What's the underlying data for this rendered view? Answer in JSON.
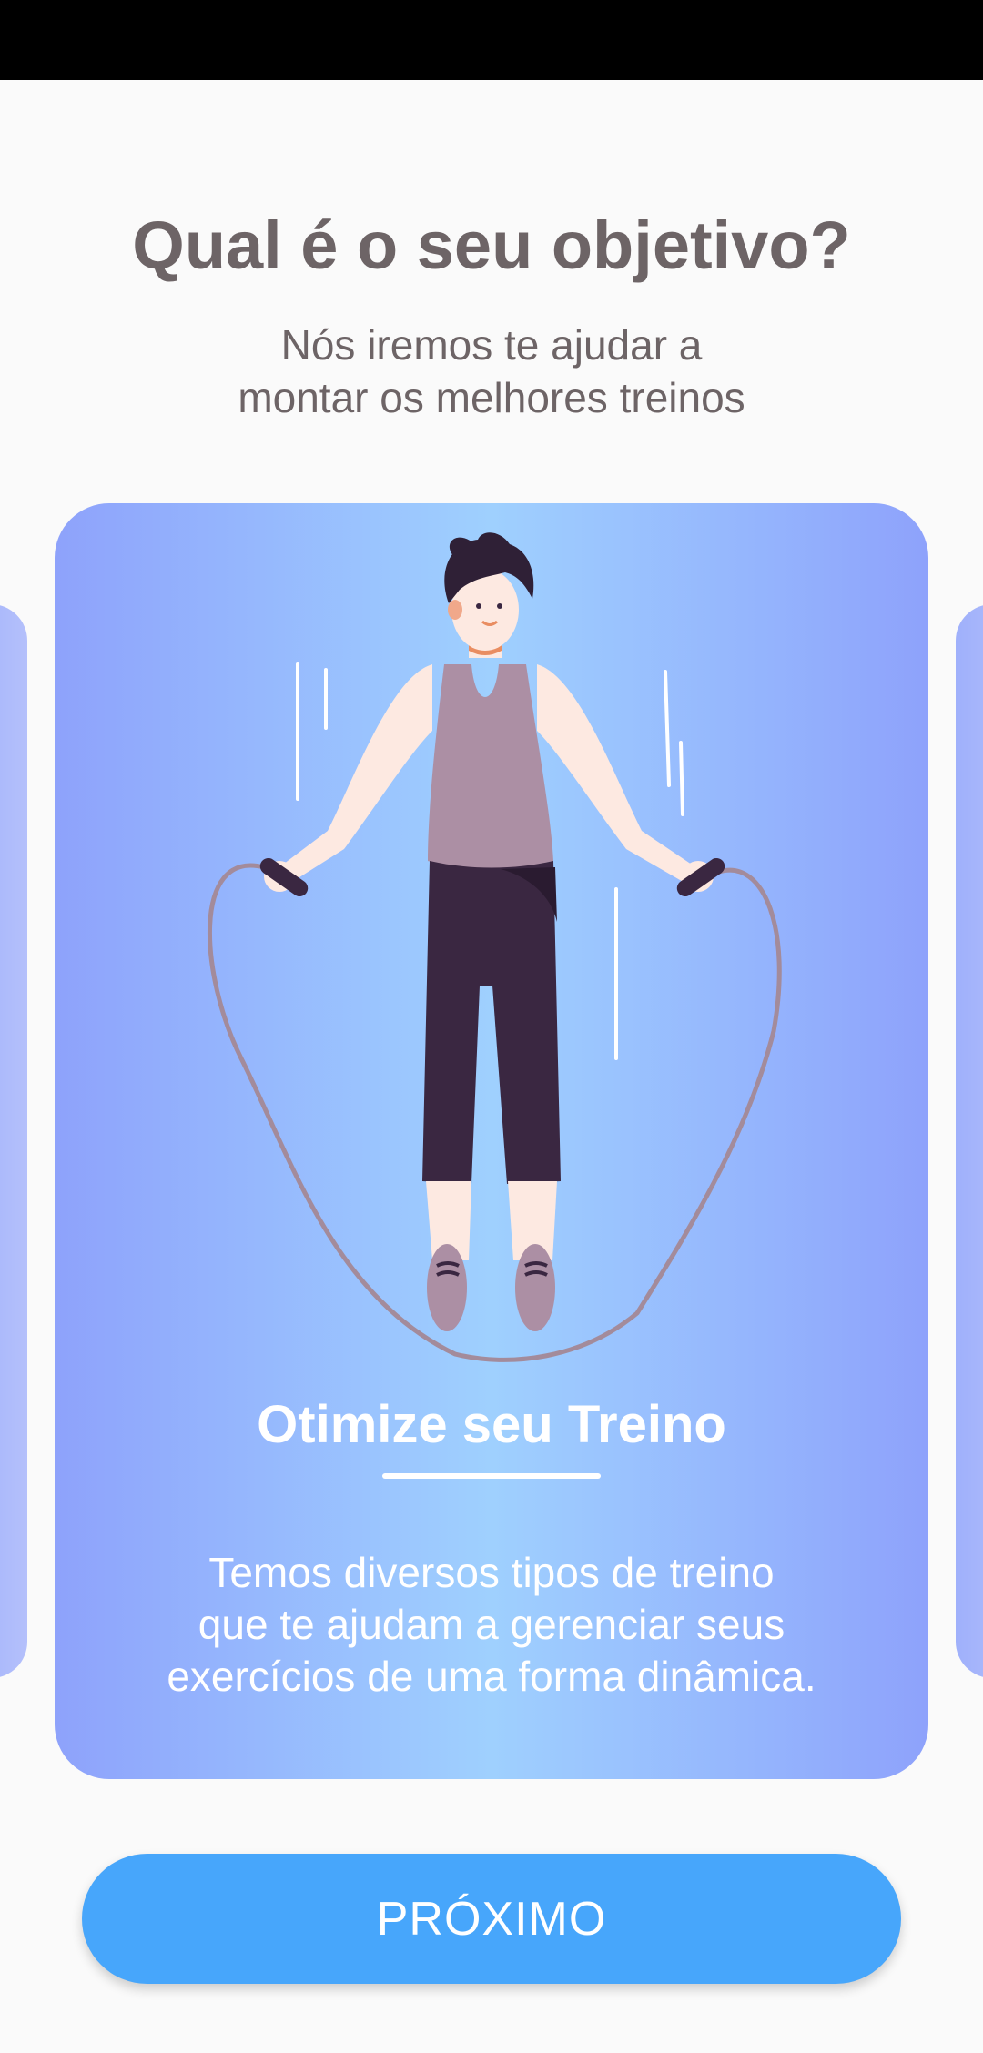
{
  "header": {
    "title": "Qual é o seu objetivo?",
    "subtitle_line1": "Nós iremos te ajudar a",
    "subtitle_line2": "montar os melhores treinos"
  },
  "card": {
    "illustration": "person-jumping-rope-illustration",
    "title": "Otimize seu Treino",
    "text_line1": "Temos diversos tipos de treino",
    "text_line2": "que te ajudam a gerenciar seus",
    "text_line3": "exercícios de uma forma dinâmica."
  },
  "footer": {
    "next_label": "PRÓXIMO"
  },
  "colors": {
    "text": "#6d6466",
    "button": "#47a6fb",
    "card_center": "#9fd0fe",
    "card_edge": "#8ea2fb"
  }
}
